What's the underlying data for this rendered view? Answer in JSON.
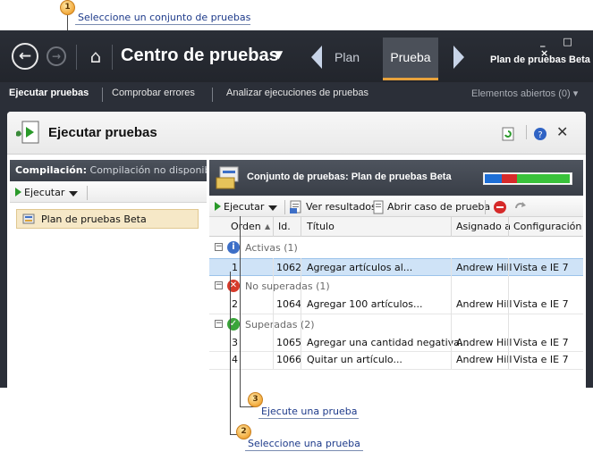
{
  "callouts": {
    "c1": {
      "num": "1",
      "text": "Seleccione un conjunto de pruebas"
    },
    "c2": {
      "num": "2",
      "text": "Seleccione una prueba"
    },
    "c3": {
      "num": "3",
      "text": "Ejecute una prueba"
    }
  },
  "titlebar": {
    "app_title": "Centro de pruebas",
    "tab_plan": "Plan",
    "tab_prueba": "Prueba",
    "plan_name": "Plan de pruebas Beta",
    "window_controls": "_ □ ×"
  },
  "subnav": {
    "items": [
      "Ejecutar pruebas",
      "Comprobar errores",
      "Analizar ejecuciones de pruebas"
    ],
    "right": "Elementos abiertos (0)"
  },
  "page": {
    "title": "Ejecutar pruebas"
  },
  "left": {
    "build_label": "Compilación:",
    "build_value": "Compilación no disponible",
    "run_label": "Ejecutar",
    "tree_item": "Plan de pruebas Beta"
  },
  "right": {
    "suite_title": "Conjunto de pruebas: Plan de pruebas Beta",
    "progress": {
      "blue": 0.2,
      "red": 0.18,
      "green": 0.62,
      "colors": {
        "blue": "#1e6fd6",
        "red": "#d62a2a",
        "green": "#39c23a"
      }
    },
    "toolbar": {
      "run_label": "Ejecutar",
      "results_label": "Ver resultados",
      "open_case_label": "Abrir caso de prueba"
    },
    "columns": [
      "Orden",
      "Id.",
      "Título",
      "Asignado a",
      "Configuración"
    ],
    "groups": [
      {
        "label": "Activas (1)",
        "icon": "info-icon",
        "color": "#3d6fc7",
        "rows": [
          {
            "order": "1",
            "id": "1062",
            "title": "Agregar artículos al...",
            "assigned": "Andrew Hill",
            "config": "Vista e IE 7"
          }
        ]
      },
      {
        "label": "No superadas (1)",
        "icon": "failed-icon",
        "color": "#d63a2a",
        "rows": [
          {
            "order": "2",
            "id": "1064",
            "title": "Agregar 100 artículos...",
            "assigned": "Andrew Hill",
            "config": "Vista e IE 7"
          }
        ]
      },
      {
        "label": "Superadas (2)",
        "icon": "passed-icon",
        "color": "#3aa53a",
        "rows": [
          {
            "order": "3",
            "id": "1065",
            "title": "Agregar una cantidad negativa...",
            "assigned": "Andrew Hill",
            "config": "Vista e IE 7"
          },
          {
            "order": "4",
            "id": "1066",
            "title": "Quitar un artículo...",
            "assigned": "Andrew Hill",
            "config": "Vista e IE 7"
          }
        ]
      }
    ]
  }
}
